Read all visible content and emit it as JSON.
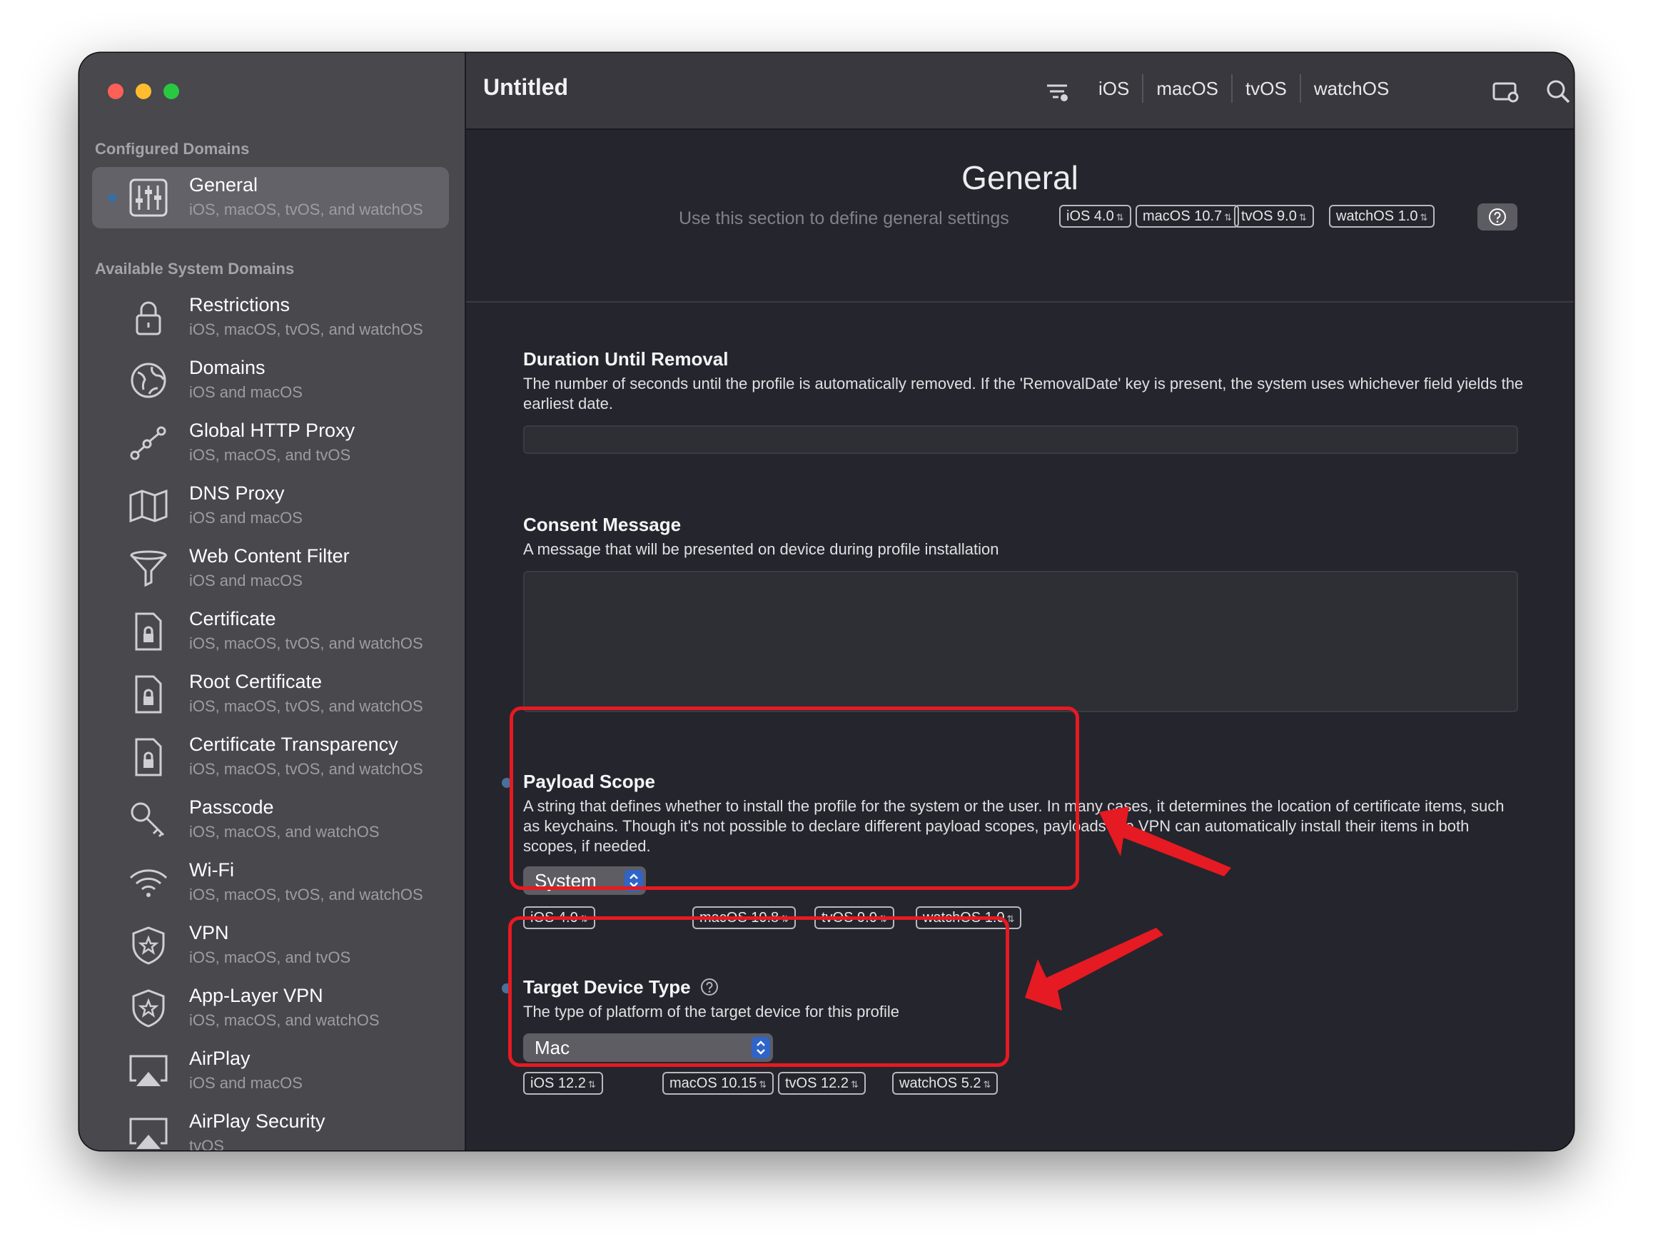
{
  "window": {
    "title": "Untitled",
    "toolbar": {
      "platforms": [
        "iOS",
        "macOS",
        "tvOS",
        "watchOS"
      ],
      "icons": [
        "filter-icon",
        "device-preview-icon",
        "search-icon",
        "help-icon"
      ]
    }
  },
  "sidebar": {
    "configured_header": "Configured Domains",
    "configured": [
      {
        "label": "General",
        "sub": "iOS, macOS, tvOS, and watchOS",
        "icon": "sliders-icon",
        "selected": true
      }
    ],
    "available_header": "Available System Domains",
    "available": [
      {
        "label": "Restrictions",
        "sub": "iOS, macOS, tvOS, and watchOS",
        "icon": "lock-icon"
      },
      {
        "label": "Domains",
        "sub": "iOS and macOS",
        "icon": "globe-icon"
      },
      {
        "label": "Global HTTP Proxy",
        "sub": "iOS, macOS, and tvOS",
        "icon": "proxy-nodes-icon"
      },
      {
        "label": "DNS Proxy",
        "sub": "iOS and macOS",
        "icon": "map-icon"
      },
      {
        "label": "Web Content Filter",
        "sub": "iOS and macOS",
        "icon": "funnel-icon"
      },
      {
        "label": "Certificate",
        "sub": "iOS, macOS, tvOS, and watchOS",
        "icon": "document-lock-icon"
      },
      {
        "label": "Root Certificate",
        "sub": "iOS, macOS, tvOS, and watchOS",
        "icon": "document-lock-icon"
      },
      {
        "label": "Certificate Transparency",
        "sub": "iOS, macOS, tvOS, and watchOS",
        "icon": "document-lock-icon"
      },
      {
        "label": "Passcode",
        "sub": "iOS, macOS, and watchOS",
        "icon": "key-icon"
      },
      {
        "label": "Wi-Fi",
        "sub": "iOS, macOS, tvOS, and watchOS",
        "icon": "wifi-icon"
      },
      {
        "label": "VPN",
        "sub": "iOS, macOS, and tvOS",
        "icon": "shield-star-icon"
      },
      {
        "label": "App-Layer VPN",
        "sub": "iOS, macOS, and watchOS",
        "icon": "shield-star-icon"
      },
      {
        "label": "AirPlay",
        "sub": "iOS and macOS",
        "icon": "airplay-icon"
      },
      {
        "label": "AirPlay Security",
        "sub": "tvOS",
        "icon": "airplay-icon"
      }
    ]
  },
  "main": {
    "title": "General",
    "description": "Use this section to define general settings",
    "platform_tags": [
      "iOS  4.0",
      "macOS  10.7",
      "tvOS  9.0",
      "watchOS  1.0"
    ],
    "fields": {
      "duration": {
        "title": "Duration Until Removal",
        "description": "The number of seconds until the profile is automatically removed. If the 'RemovalDate' key is present, the system uses whichever field yields the earliest date.",
        "value": ""
      },
      "consent": {
        "title": "Consent Message",
        "description": "A message that will be presented on device during profile installation",
        "value": ""
      },
      "payload_scope": {
        "title": "Payload Scope",
        "description": "A string that defines whether to install the profile for the system or the user. In many cases, it determines the location of certificate items, such as keychains. Though it's not possible to declare different payload scopes, payloads like VPN can automatically install their items in both scopes, if needed.",
        "selected": "System",
        "tags": [
          "iOS  4.0",
          "macOS  10.8",
          "tvOS  9.0",
          "watchOS  1.0"
        ]
      },
      "target_device": {
        "title": "Target Device Type",
        "description": "The type of platform of the target device for this profile",
        "selected": "Mac",
        "tags": [
          "iOS  12.2",
          "macOS  10.15",
          "tvOS  12.2",
          "watchOS  5.2"
        ]
      }
    }
  },
  "annotations": {
    "highlight_color": "#e51a22"
  }
}
